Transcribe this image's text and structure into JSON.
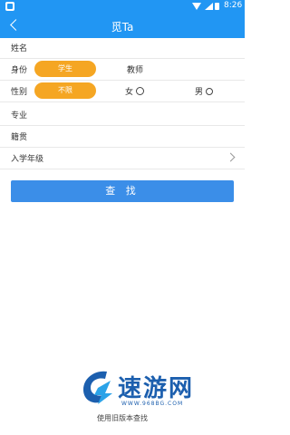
{
  "status_bar": {
    "time": "8:26"
  },
  "header": {
    "title": "觅Ta"
  },
  "form": {
    "name": {
      "label": "姓名"
    },
    "identity": {
      "label": "身份",
      "options": [
        "学生",
        "教师"
      ],
      "selected": "学生"
    },
    "gender": {
      "label": "性别",
      "options": [
        "不限",
        "女",
        "男"
      ],
      "selected": "不限"
    },
    "major": {
      "label": "专业"
    },
    "hometown": {
      "label": "籍贯"
    },
    "enrollment_year": {
      "label": "入学年级"
    }
  },
  "search_button": {
    "label": "查 找"
  },
  "watermark": {
    "brand": "速游网",
    "url": "WWW.968BG.COM"
  },
  "old_version_link": {
    "label": "使用旧版本查找"
  },
  "colors": {
    "primary": "#2196f3",
    "accent": "#f5a623",
    "button": "#3b8ee8"
  },
  "icons": [
    "back-arrow-icon",
    "wifi-icon",
    "signal-icon",
    "battery-icon",
    "female-icon",
    "male-icon",
    "chevron-right-icon"
  ]
}
